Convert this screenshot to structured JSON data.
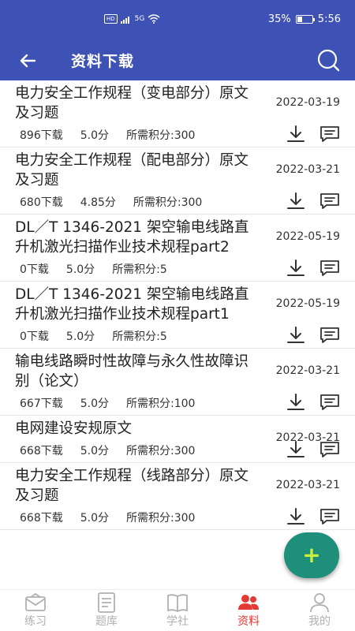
{
  "status": {
    "network": "5G",
    "battery_text": "35%",
    "battery_level": 0.35,
    "time": "5:56"
  },
  "header": {
    "title": "资料下载"
  },
  "items": [
    {
      "title": "电力安全工作规程（变电部分）原文及习题",
      "date": "2022-03-19",
      "downloads": "896下载",
      "score": "5.0分",
      "points": "所需积分:300"
    },
    {
      "title": "电力安全工作规程（配电部分）原文及习题",
      "date": "2022-03-21",
      "downloads": "680下载",
      "score": "4.85分",
      "points": "所需积分:300"
    },
    {
      "title": "DL／T 1346-2021 架空输电线路直升机激光扫描作业技术规程part2",
      "date": "2022-05-19",
      "downloads": "0下载",
      "score": "5.0分",
      "points": "所需积分:5"
    },
    {
      "title": "DL／T 1346-2021 架空输电线路直升机激光扫描作业技术规程part1",
      "date": "2022-05-19",
      "downloads": "0下载",
      "score": "5.0分",
      "points": "所需积分:5"
    },
    {
      "title": "输电线路瞬时性故障与永久性故障识别（论文）",
      "date": "2022-03-21",
      "downloads": "667下载",
      "score": "5.0分",
      "points": "所需积分:100"
    },
    {
      "title": "电网建设安规原文",
      "date": "2022-03-21",
      "downloads": "668下载",
      "score": "5.0分",
      "points": "所需积分:300"
    },
    {
      "title": "电力安全工作规程（线路部分）原文及习题",
      "date": "2022-03-21",
      "downloads": "668下载",
      "score": "5.0分",
      "points": "所需积分:300"
    }
  ],
  "fab": {
    "label": "+"
  },
  "nav": [
    {
      "label": "练习",
      "icon": "envelope-icon"
    },
    {
      "label": "题库",
      "icon": "document-icon"
    },
    {
      "label": "学社",
      "icon": "book-icon"
    },
    {
      "label": "资料",
      "icon": "people-icon",
      "active": true
    },
    {
      "label": "我的",
      "icon": "person-icon"
    }
  ],
  "colors": {
    "primary": "#3e51b5",
    "accent": "#1d8f7a",
    "active_nav": "#e53935"
  }
}
